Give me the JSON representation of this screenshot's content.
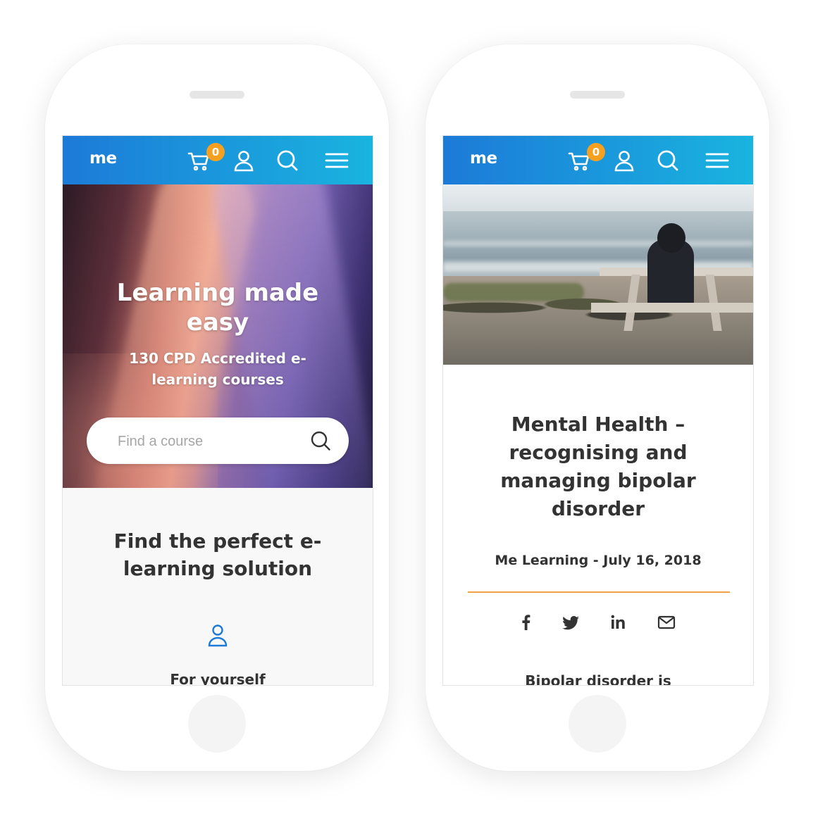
{
  "brand": {
    "logo": "me",
    "accent": "#1c7ad8",
    "accent_end": "#19b4df",
    "badge_color": "#f5a01f",
    "divider_color": "#f0a246"
  },
  "header": {
    "cart_count": "0",
    "icons": [
      "cart-icon",
      "user-icon",
      "search-icon",
      "menu-icon"
    ]
  },
  "home": {
    "hero_title": "Learning made easy",
    "hero_subtitle": "130 CPD Accredited e-learning courses",
    "search_placeholder": "Find a course",
    "section_title": "Find the perfect e-learning solution",
    "audience_label": "For yourself"
  },
  "article": {
    "title": "Mental Health – recognising and managing bipolar disorder",
    "meta": "Me Learning - July 16, 2018",
    "share_icons": [
      "facebook-icon",
      "twitter-icon",
      "linkedin-icon",
      "email-icon"
    ],
    "body_start": "Bipolar disorder is"
  }
}
